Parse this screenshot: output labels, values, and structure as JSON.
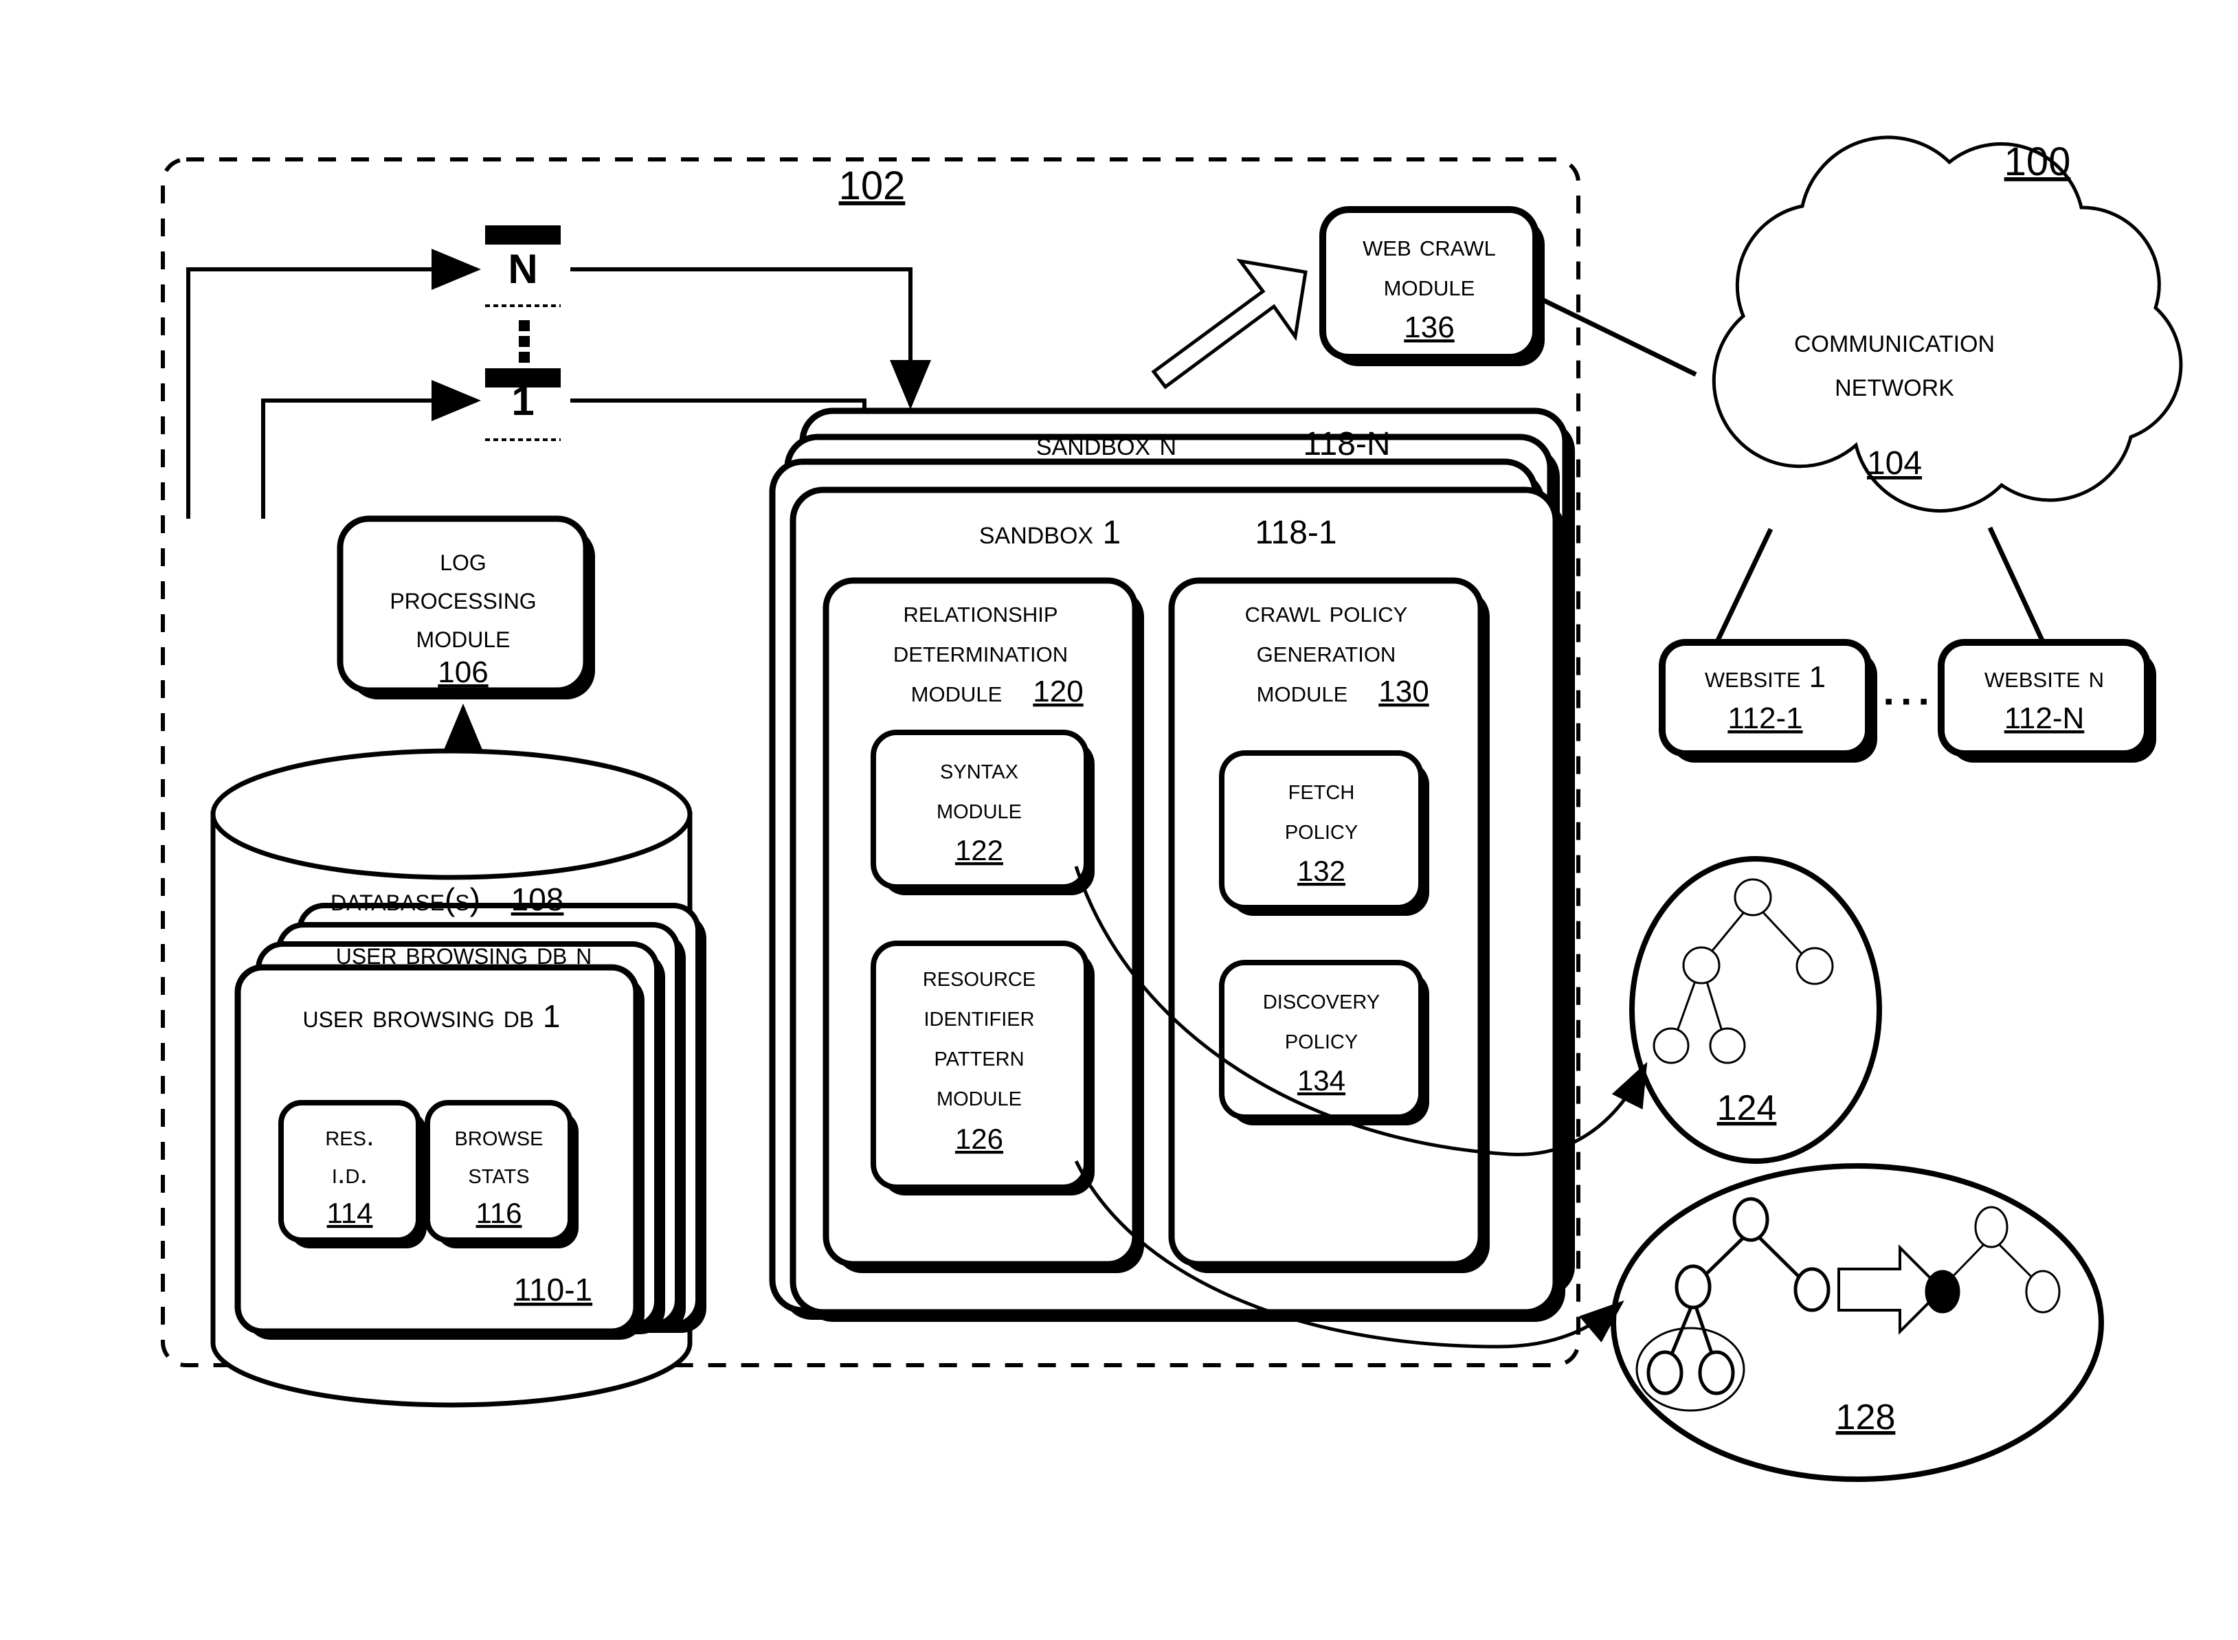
{
  "figure": {
    "system_ref": "100",
    "crawl_system_ref": "102"
  },
  "queue": {
    "top_label": "N",
    "bottom_label": "1"
  },
  "log_processing_module": {
    "line1": "Log",
    "line2": "Processing",
    "line3": "Module",
    "ref": "106"
  },
  "database": {
    "title": "Database(s)",
    "ref": "108",
    "db_n_label": "User Browsing DB N",
    "db_1_label": "User Browsing DB 1",
    "db_1_ref": "110-1",
    "res_id": {
      "line1": "Res.",
      "line2": "I.D.",
      "ref": "114"
    },
    "browse_stats": {
      "line1": "Browse",
      "line2": "Stats",
      "ref": "116"
    }
  },
  "sandbox_n": {
    "label": "Sandbox N",
    "ref": "118-N"
  },
  "sandbox_1": {
    "label": "Sandbox 1",
    "ref": "118-1",
    "relationship_module": {
      "line1": "Relationship",
      "line2": "Determination",
      "line3": "Module",
      "ref": "120"
    },
    "syntax_module": {
      "line1": "Syntax",
      "line2": "Module",
      "ref": "122"
    },
    "resource_identifier_pattern_module": {
      "line1": "Resource",
      "line2": "Identifier",
      "line3": "Pattern",
      "line4": "Module",
      "ref": "126"
    },
    "crawl_policy_module": {
      "line1": "Crawl Policy",
      "line2": "Generation",
      "line3": "Module",
      "ref": "130"
    },
    "fetch_policy": {
      "line1": "Fetch",
      "line2": "Policy",
      "ref": "132"
    },
    "discovery_policy": {
      "line1": "Discovery",
      "line2": "Policy",
      "ref": "134"
    }
  },
  "web_crawl_module": {
    "line1": "Web Crawl",
    "line2": "Module",
    "ref": "136"
  },
  "communication_network": {
    "line1": "Communication",
    "line2": "Network",
    "ref": "104"
  },
  "websites": {
    "website_1": {
      "label": "Website 1",
      "ref": "112-1"
    },
    "website_n": {
      "label": "Website N",
      "ref": "112-N"
    },
    "ellipsis": "▪ ▪ ▪"
  },
  "tree_graph_124": {
    "ref": "124"
  },
  "tree_graph_128": {
    "ref": "128"
  },
  "colors": {
    "ink": "#000000",
    "paper": "#ffffff"
  }
}
